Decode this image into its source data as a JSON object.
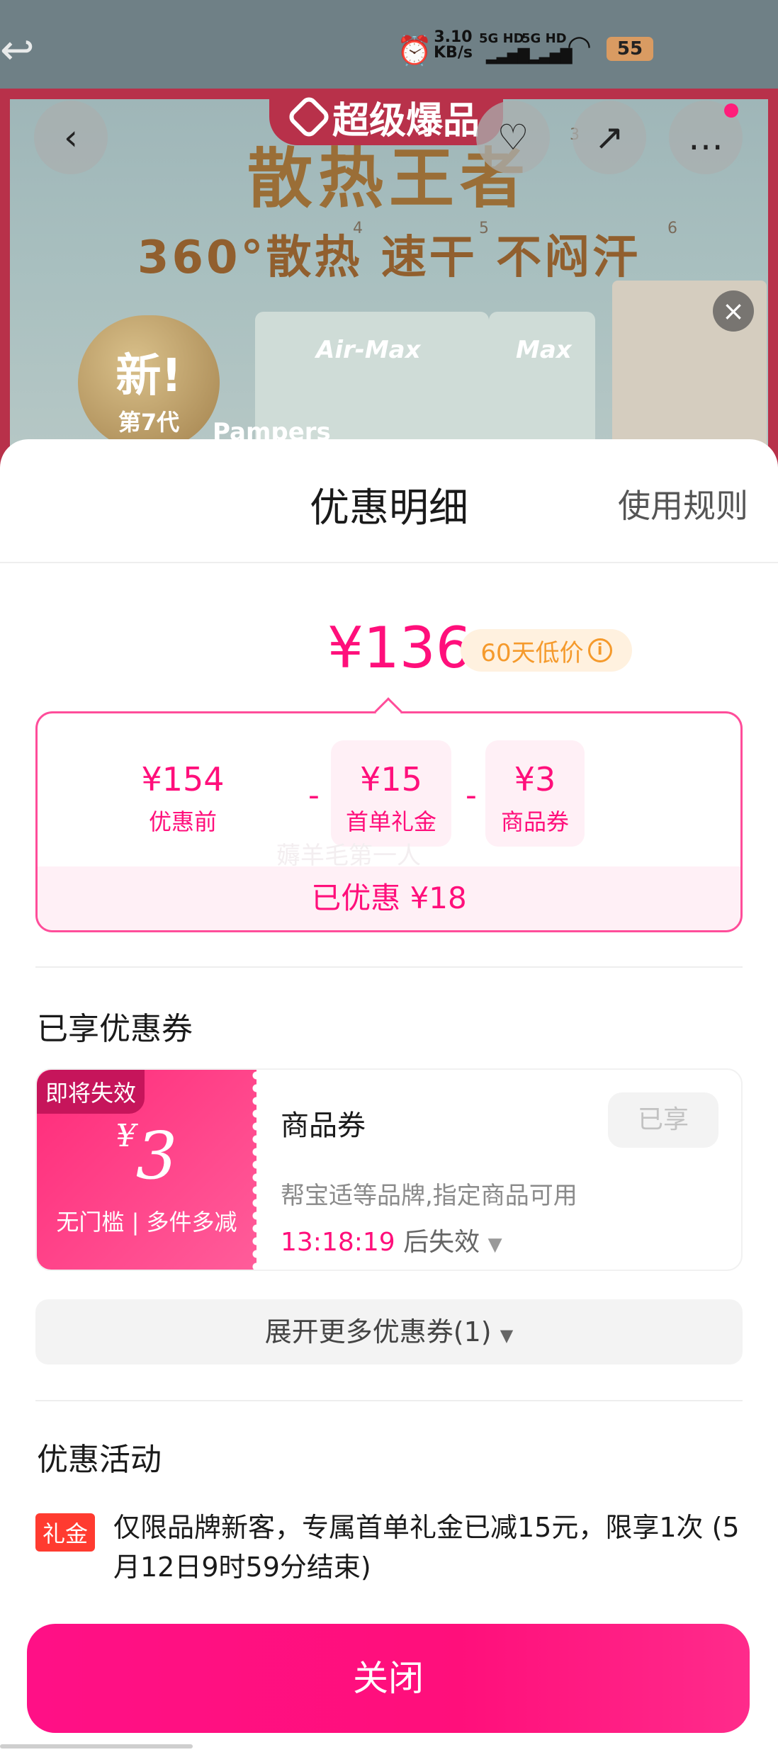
{
  "status_bar": {
    "net_speed_value": "3.10",
    "net_speed_unit": "KB/s",
    "net1": "5G HD",
    "net2": "5G HD",
    "battery": "55"
  },
  "background": {
    "badge_label": "超级爆品",
    "hero_title": "散热王者",
    "hero_sub": "360°散热 速干 不闷汗",
    "sup_3": "3",
    "sup_4": "4",
    "sup_5": "5",
    "sup_6": "6",
    "new_badge_big": "新!",
    "new_badge_small": "第7代",
    "pack_label": "Air-Max",
    "pack_label_2": "Max",
    "brand": "Pampers"
  },
  "sheet": {
    "title": "优惠明细",
    "rules_link": "使用规则"
  },
  "price": {
    "final": "¥136",
    "low_tag": "60天低价",
    "info_icon": "i"
  },
  "breakdown": {
    "items": [
      {
        "value": "¥154",
        "label": "优惠前"
      },
      {
        "value": "¥15",
        "label": "首单礼金"
      },
      {
        "value": "¥3",
        "label": "商品券"
      }
    ],
    "minus": "-",
    "total": "已优惠 ¥18",
    "watermark": "薅羊毛第一人"
  },
  "coupons_section": {
    "title": "已享优惠券",
    "coupon": {
      "expire_tag": "即将失效",
      "yen": "¥",
      "amount": "3",
      "condition": "无门槛 | 多件多减",
      "name": "商品券",
      "status": "已享",
      "desc": "帮宝适等品牌,指定商品可用",
      "timer": "13:18:19",
      "timer_suffix": "后失效"
    },
    "expand": "展开更多优惠券(1)"
  },
  "activities_section": {
    "title": "优惠活动",
    "tag": "礼金",
    "text": "仅限品牌新客，专属首单礼金已减15元，限享1次 (5月12日9时59分结束)"
  },
  "close_button": "关闭",
  "colors": {
    "accent": "#ff0f7b",
    "orange": "#f59a2c",
    "tag_red": "#ff3b30"
  }
}
